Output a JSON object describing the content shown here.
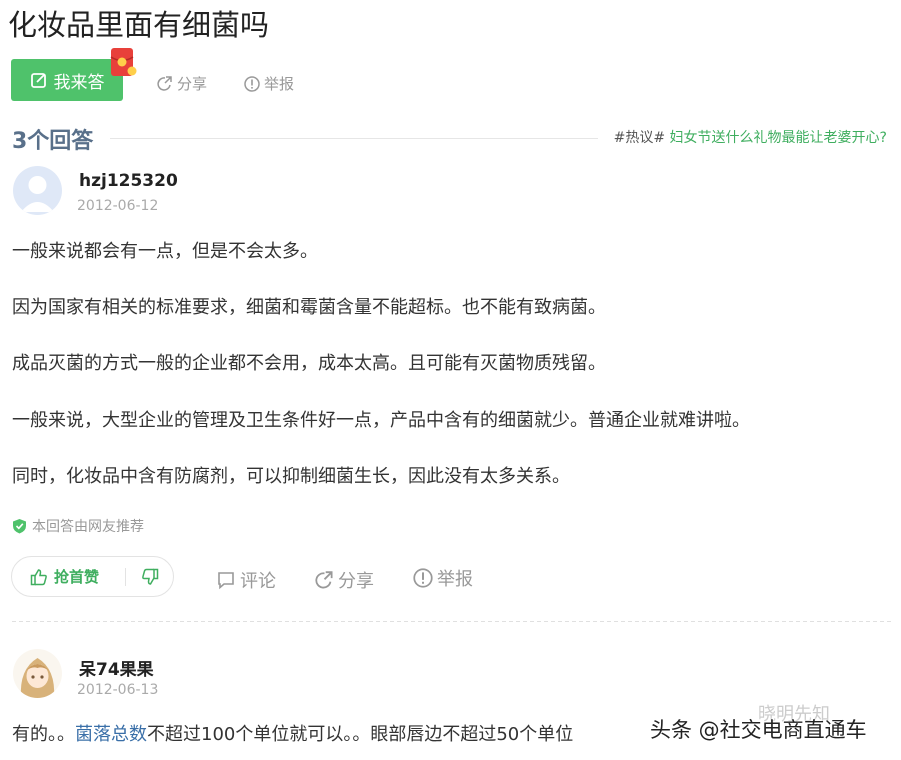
{
  "question": {
    "title": "化妆品里面有细菌吗"
  },
  "actions": {
    "answer_label": "我来答",
    "share_label": "分享",
    "report_label": "举报"
  },
  "answers_header": {
    "count_label": "3个回答",
    "hot_tag": "#热议#",
    "hot_link": "妇女节送什么礼物最能让老婆开心?"
  },
  "answer1": {
    "user": "hzj125320",
    "date": "2012-06-12",
    "paragraphs": [
      "一般来说都会有一点，但是不会太多。",
      "因为国家有相关的标准要求，细菌和霉菌含量不能超标。也不能有致病菌。",
      "成品灭菌的方式一般的企业都不会用，成本太高。且可能有灭菌物质残留。",
      "一般来说，大型企业的管理及卫生条件好一点，产品中含有的细菌就少。普通企业就难讲啦。",
      "同时，化妆品中含有防腐剂，可以抑制细菌生长，因此没有太多关系。"
    ],
    "recommend_note": "本回答由网友推荐",
    "like_label": "抢首赞",
    "comment_label": "评论",
    "share_label": "分享",
    "report_label": "举报"
  },
  "answer2": {
    "user": "呆74果果",
    "date": "2012-06-13",
    "text_before": "有的。。",
    "keyword": "菌落总数",
    "text_after": "不超过100个单位就可以。。眼部唇边不超过50个单位"
  },
  "watermark": {
    "text": "头条 @社交电商直通车",
    "faint": "晓明先知"
  },
  "colors": {
    "accent_green": "#4fc26b",
    "link_blue": "#3a6fa8",
    "count_blue": "#59708a"
  }
}
